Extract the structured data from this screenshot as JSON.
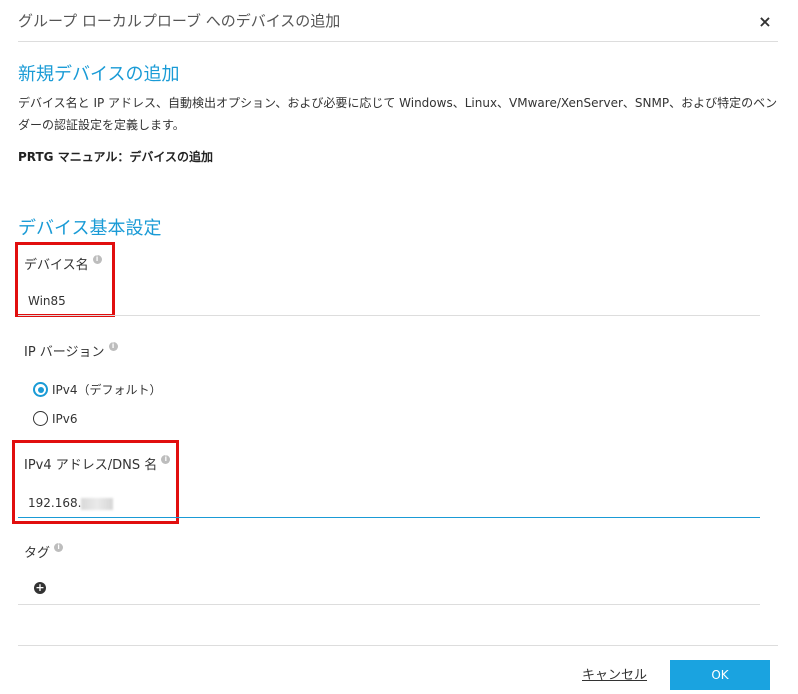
{
  "dialog": {
    "title": "グループ ローカルプローブ へのデバイスの追加",
    "close_label": "×"
  },
  "new_device": {
    "section_title": "新規デバイスの追加",
    "description": "デバイス名と IP アドレス、自動検出オプション、および必要に応じて Windows、Linux、VMware/XenServer、SNMP、および特定のベンダーの認証設定を定義します。",
    "manual_link": "PRTG マニュアル：デバイスの追加"
  },
  "basic_settings": {
    "section_title": "デバイス基本設定",
    "device_name": {
      "label": "デバイス名",
      "value": "Win85"
    },
    "ip_version": {
      "label": "IP バージョン",
      "options": [
        {
          "label": "IPv4（デフォルト）",
          "selected": true
        },
        {
          "label": "IPv6",
          "selected": false
        }
      ]
    },
    "ipv4_address": {
      "label": "IPv4 アドレス/DNS 名",
      "value_prefix": "192.168."
    },
    "tags": {
      "label": "タグ",
      "add_label": "+"
    }
  },
  "footer": {
    "cancel_label": "キャンセル",
    "ok_label": "OK"
  },
  "colors": {
    "accent": "#1a9bd6",
    "highlight": "#e10e0e",
    "ok_button": "#1aa3e0"
  },
  "icons": [
    "info-icon",
    "close-icon",
    "plus-circle-icon"
  ]
}
